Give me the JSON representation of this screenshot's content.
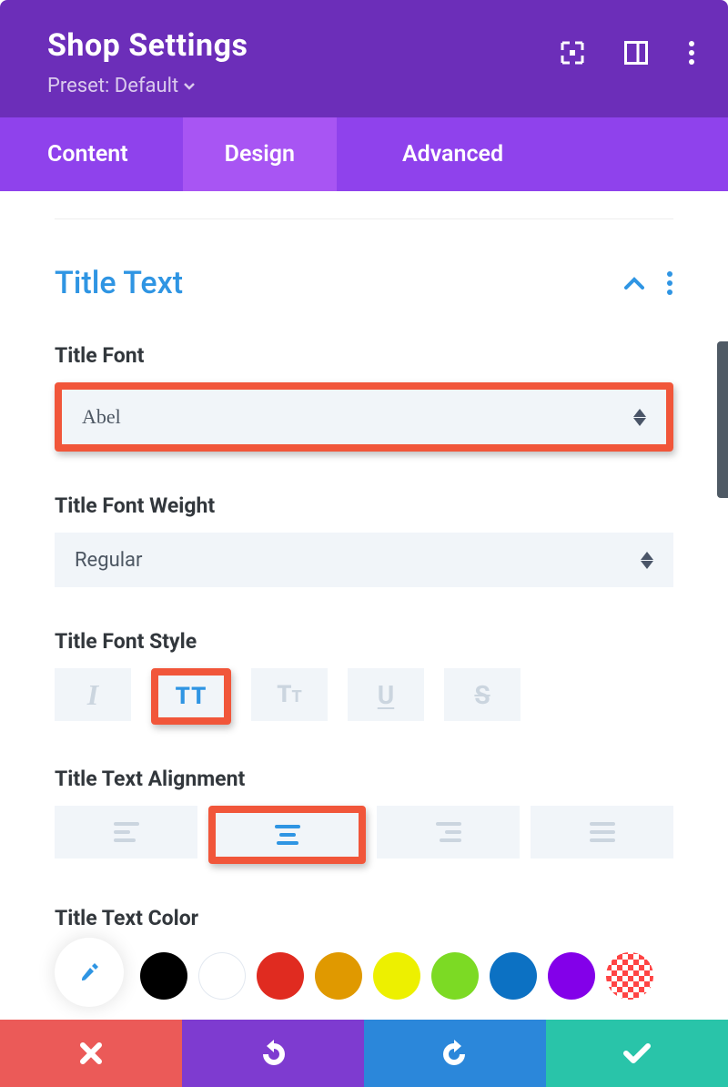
{
  "header": {
    "title": "Shop Settings",
    "preset_label": "Preset: Default"
  },
  "tabs": {
    "content": "Content",
    "design": "Design",
    "advanced": "Advanced"
  },
  "section": {
    "title": "Title Text"
  },
  "fields": {
    "font_label": "Title Font",
    "font_value": "Abel",
    "weight_label": "Title Font Weight",
    "weight_value": "Regular",
    "style_label": "Title Font Style",
    "align_label": "Title Text Alignment",
    "color_label": "Title Text Color"
  },
  "colors": {
    "swatches": [
      "#000000",
      "#ffffff",
      "#e02b20",
      "#e09900",
      "#edf000",
      "#7cda24",
      "#0c71c3",
      "#8300e9"
    ]
  }
}
